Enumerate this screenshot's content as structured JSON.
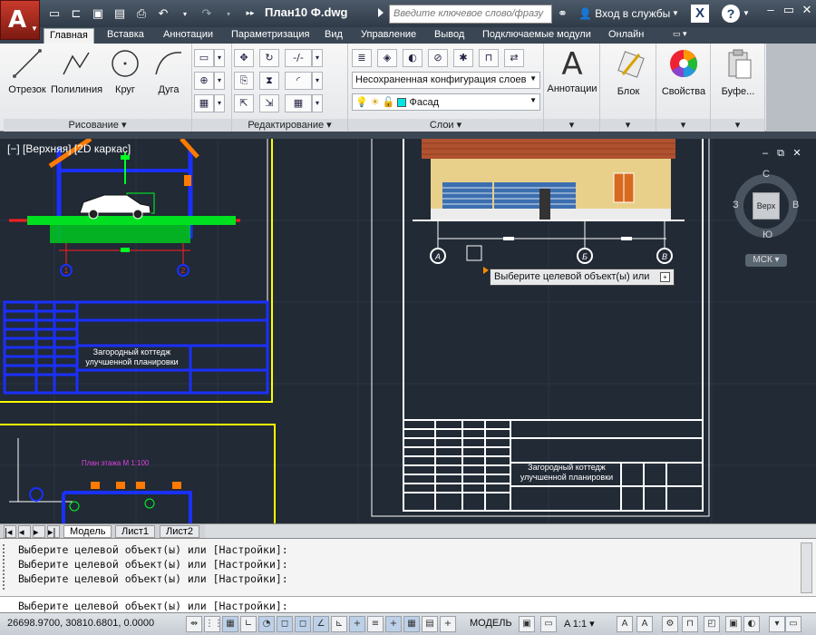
{
  "app": {
    "title": "План10 Ф.dwg",
    "search_placeholder": "Введите ключевое слово/фразу",
    "signin": "Вход в службы",
    "help": "?"
  },
  "tabs": [
    "Главная",
    "Вставка",
    "Аннотации",
    "Параметризация",
    "Вид",
    "Управление",
    "Вывод",
    "Подключаемые модули",
    "Онлайн"
  ],
  "ribbon": {
    "draw": {
      "title": "Рисование",
      "line": "Отрезок",
      "polyline": "Полилиния",
      "circle": "Круг",
      "arc": "Дуга"
    },
    "modify": {
      "title": "Редактирование"
    },
    "layers": {
      "title": "Слои",
      "config": "Несохраненная конфигурация слоев",
      "current_layer": "Фасад"
    },
    "annotation": "Аннотации",
    "block": "Блок",
    "properties": "Свойства",
    "clipboard": "Буфе..."
  },
  "viewport": {
    "label": "[−] [Верхняя] [2D каркас]",
    "viewcube": {
      "n": "С",
      "s": "Ю",
      "w": "З",
      "e": "В",
      "face": "Верх",
      "ucs": "МСК"
    }
  },
  "drawing": {
    "title_block_left": "Загородный коттедж\nулучшенной планировки",
    "title_block_right": "Загородный коттедж\nулучшенной планировки",
    "plan_title": "План этажа М 1:100",
    "axis_labels": [
      "1",
      "2",
      "А",
      "Б",
      "В"
    ]
  },
  "tooltip": "Выберите целевой объект(ы) или",
  "layout_tabs": [
    "Модель",
    "Лист1",
    "Лист2"
  ],
  "command": {
    "history": [
      "Выберите целевой объект(ы) или [Настройки]:",
      "Выберите целевой объект(ы) или [Настройки]:",
      "Выберите целевой объект(ы) или [Настройки]:"
    ],
    "prompt": "Выберите целевой объект(ы) или [Настройки]:"
  },
  "status": {
    "coords": "26698.9700, 30810.6801, 0.0000",
    "model": "МОДЕЛЬ",
    "scale": "A 1:1"
  }
}
